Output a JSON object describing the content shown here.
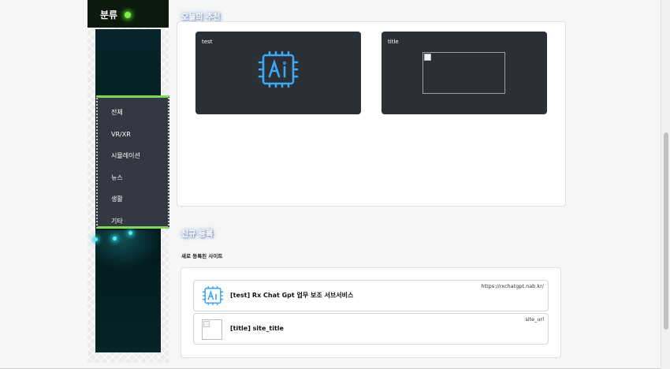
{
  "sidebar": {
    "title": "분류",
    "menu": [
      "전체",
      "VR/XR",
      "시뮬레이션",
      "뉴스",
      "생활",
      "기타"
    ]
  },
  "recommend": {
    "title": "오늘의 추천",
    "cards": [
      {
        "label": "test",
        "icon": "ai-chip-icon"
      },
      {
        "label": "title",
        "icon": "broken-image-icon"
      }
    ]
  },
  "new_sites": {
    "title": "신규 등록",
    "subtitle": "새로 등록된 사이트",
    "items": [
      {
        "name": "[test] Rx Chat Gpt 업무 보조 서브서비스",
        "url": "https://rxchatgpt.nab.kr/",
        "icon": "ai-chip-icon"
      },
      {
        "name": "[title] site_title",
        "url": "site_url",
        "icon": "broken-image-icon"
      }
    ]
  },
  "colors": {
    "accent_green": "#7ed957",
    "ai_icon_blue": "#3da9f5",
    "card_bg": "#2b3036"
  }
}
